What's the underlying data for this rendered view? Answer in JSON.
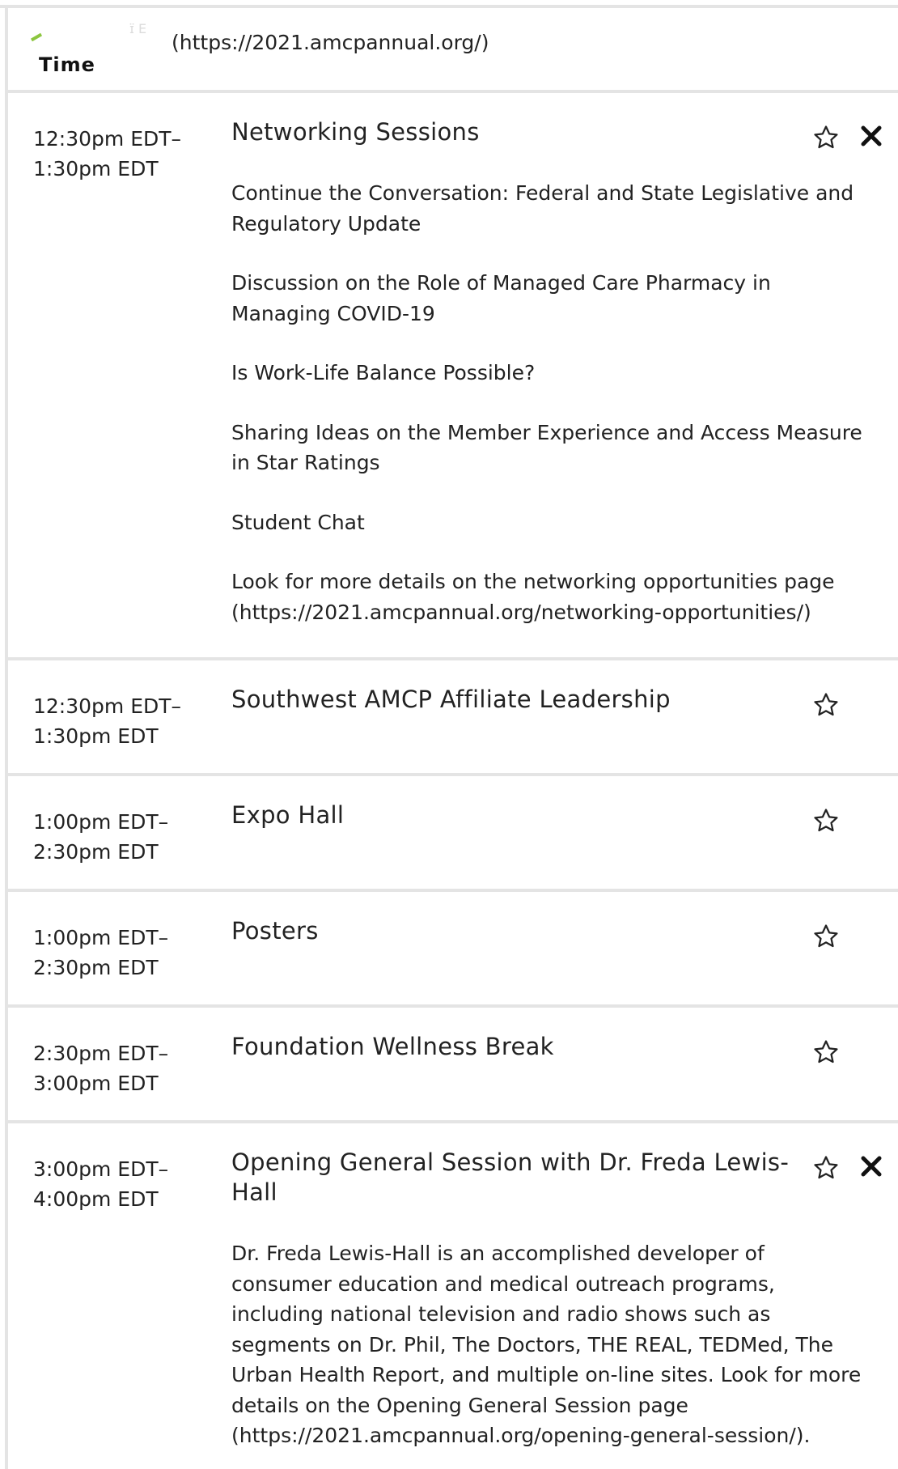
{
  "header": {
    "logo_text": "Time",
    "logo_faint": "ɪ̈ E",
    "url_text": "(https://2021.amcpannual.org/)"
  },
  "sessions": [
    {
      "time_start": "12:30pm EDT–",
      "time_end": "1:30pm EDT",
      "title": "Networking Sessions",
      "items": [
        "Continue the Conversation: Federal and State Legislative and Regulatory Update",
        "Discussion on the Role of Managed Care Pharmacy in Managing COVID-19",
        "Is Work-Life Balance Possible?",
        "Sharing Ideas on the Member Experience and Access Measure in Star Ratings",
        "Student Chat",
        "Look for more details on the networking opportunities page (https://2021.amcpannual.org/networking-opportunities/)"
      ]
    },
    {
      "time_start": "12:30pm EDT–",
      "time_end": "1:30pm EDT",
      "title": "Southwest AMCP Affiliate Leadership"
    },
    {
      "time_start": "1:00pm EDT–",
      "time_end": "2:30pm EDT",
      "title": "Expo Hall"
    },
    {
      "time_start": "1:00pm EDT–",
      "time_end": "2:30pm EDT",
      "title": "Posters"
    },
    {
      "time_start": "2:30pm EDT–",
      "time_end": "3:00pm EDT",
      "title": "Foundation Wellness Break"
    },
    {
      "time_start": "3:00pm EDT–",
      "time_end": "4:00pm EDT",
      "title": "Opening General Session with Dr. Freda Lewis-Hall",
      "description": "Dr. Freda Lewis-Hall is an accomplished developer of consumer education and medical outreach programs, including national television and radio shows such as segments on Dr. Phil, The Doctors, THE REAL, TEDMed, The Urban Health Report, and multiple on-line sites. Look for more details on the Opening General Session page (https://2021.amcpannual.org/opening-general-session/)."
    }
  ],
  "icons": {
    "star": "star-outline-icon",
    "close": "close-icon"
  },
  "colors": {
    "text": "#222222",
    "divider": "#e4e4e4",
    "logo_accent": "#8cc63f"
  }
}
